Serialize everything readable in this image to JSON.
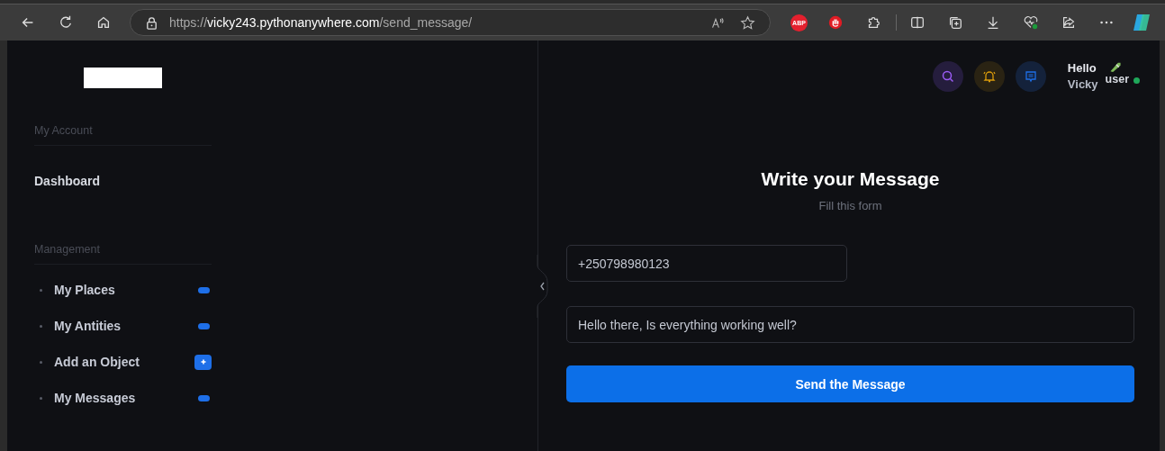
{
  "browser": {
    "address": {
      "scheme": "https://",
      "host": "vicky243.pythonanywhere.com",
      "path": "/send_message/"
    },
    "extensions": [
      {
        "kind": "abp",
        "label": "ABP"
      }
    ]
  },
  "sidebar": {
    "sections": [
      {
        "title": "My Account",
        "items": [
          {
            "label": "Dashboard",
            "kind": "plain"
          }
        ]
      },
      {
        "title": "Management",
        "items": [
          {
            "label": "My Places",
            "kind": "pill"
          },
          {
            "label": "My Antities",
            "kind": "pill"
          },
          {
            "label": "Add an Object",
            "kind": "plus"
          },
          {
            "label": "My Messages",
            "kind": "pill"
          }
        ]
      }
    ]
  },
  "header": {
    "greeting": "Hello",
    "name": "Vicky",
    "avatar_alt": "user",
    "online": true
  },
  "form": {
    "title": "Write your Message",
    "subtitle": "Fill this form",
    "phone": {
      "value": "+250798980123"
    },
    "message": {
      "value": "Hello there, Is everything working well?"
    },
    "submit": "Send the Message"
  }
}
